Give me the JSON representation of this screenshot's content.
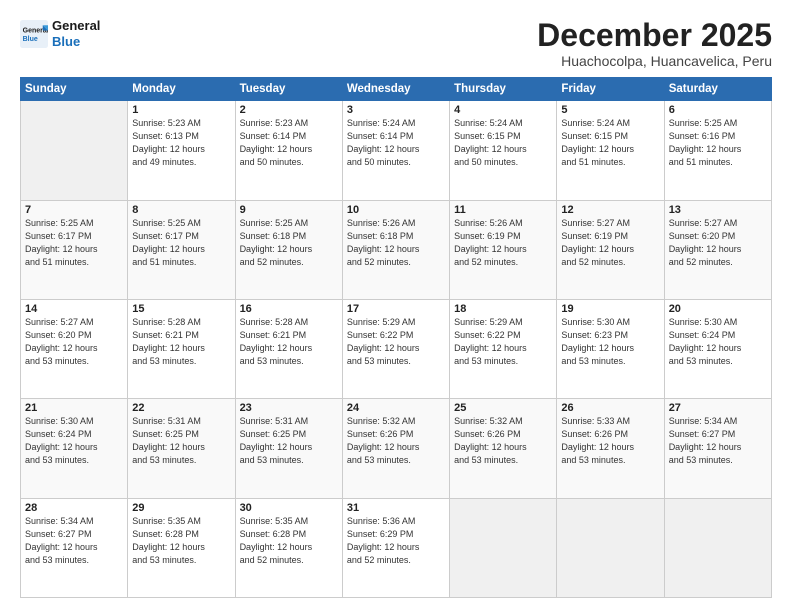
{
  "logo": {
    "line1": "General",
    "line2": "Blue"
  },
  "title": "December 2025",
  "subtitle": "Huachocolpa, Huancavelica, Peru",
  "weekdays": [
    "Sunday",
    "Monday",
    "Tuesday",
    "Wednesday",
    "Thursday",
    "Friday",
    "Saturday"
  ],
  "weeks": [
    [
      {
        "day": null,
        "info": null
      },
      {
        "day": "1",
        "info": "Sunrise: 5:23 AM\nSunset: 6:13 PM\nDaylight: 12 hours\nand 49 minutes."
      },
      {
        "day": "2",
        "info": "Sunrise: 5:23 AM\nSunset: 6:14 PM\nDaylight: 12 hours\nand 50 minutes."
      },
      {
        "day": "3",
        "info": "Sunrise: 5:24 AM\nSunset: 6:14 PM\nDaylight: 12 hours\nand 50 minutes."
      },
      {
        "day": "4",
        "info": "Sunrise: 5:24 AM\nSunset: 6:15 PM\nDaylight: 12 hours\nand 50 minutes."
      },
      {
        "day": "5",
        "info": "Sunrise: 5:24 AM\nSunset: 6:15 PM\nDaylight: 12 hours\nand 51 minutes."
      },
      {
        "day": "6",
        "info": "Sunrise: 5:25 AM\nSunset: 6:16 PM\nDaylight: 12 hours\nand 51 minutes."
      }
    ],
    [
      {
        "day": "7",
        "info": "Sunrise: 5:25 AM\nSunset: 6:17 PM\nDaylight: 12 hours\nand 51 minutes."
      },
      {
        "day": "8",
        "info": "Sunrise: 5:25 AM\nSunset: 6:17 PM\nDaylight: 12 hours\nand 51 minutes."
      },
      {
        "day": "9",
        "info": "Sunrise: 5:25 AM\nSunset: 6:18 PM\nDaylight: 12 hours\nand 52 minutes."
      },
      {
        "day": "10",
        "info": "Sunrise: 5:26 AM\nSunset: 6:18 PM\nDaylight: 12 hours\nand 52 minutes."
      },
      {
        "day": "11",
        "info": "Sunrise: 5:26 AM\nSunset: 6:19 PM\nDaylight: 12 hours\nand 52 minutes."
      },
      {
        "day": "12",
        "info": "Sunrise: 5:27 AM\nSunset: 6:19 PM\nDaylight: 12 hours\nand 52 minutes."
      },
      {
        "day": "13",
        "info": "Sunrise: 5:27 AM\nSunset: 6:20 PM\nDaylight: 12 hours\nand 52 minutes."
      }
    ],
    [
      {
        "day": "14",
        "info": "Sunrise: 5:27 AM\nSunset: 6:20 PM\nDaylight: 12 hours\nand 53 minutes."
      },
      {
        "day": "15",
        "info": "Sunrise: 5:28 AM\nSunset: 6:21 PM\nDaylight: 12 hours\nand 53 minutes."
      },
      {
        "day": "16",
        "info": "Sunrise: 5:28 AM\nSunset: 6:21 PM\nDaylight: 12 hours\nand 53 minutes."
      },
      {
        "day": "17",
        "info": "Sunrise: 5:29 AM\nSunset: 6:22 PM\nDaylight: 12 hours\nand 53 minutes."
      },
      {
        "day": "18",
        "info": "Sunrise: 5:29 AM\nSunset: 6:22 PM\nDaylight: 12 hours\nand 53 minutes."
      },
      {
        "day": "19",
        "info": "Sunrise: 5:30 AM\nSunset: 6:23 PM\nDaylight: 12 hours\nand 53 minutes."
      },
      {
        "day": "20",
        "info": "Sunrise: 5:30 AM\nSunset: 6:24 PM\nDaylight: 12 hours\nand 53 minutes."
      }
    ],
    [
      {
        "day": "21",
        "info": "Sunrise: 5:30 AM\nSunset: 6:24 PM\nDaylight: 12 hours\nand 53 minutes."
      },
      {
        "day": "22",
        "info": "Sunrise: 5:31 AM\nSunset: 6:25 PM\nDaylight: 12 hours\nand 53 minutes."
      },
      {
        "day": "23",
        "info": "Sunrise: 5:31 AM\nSunset: 6:25 PM\nDaylight: 12 hours\nand 53 minutes."
      },
      {
        "day": "24",
        "info": "Sunrise: 5:32 AM\nSunset: 6:26 PM\nDaylight: 12 hours\nand 53 minutes."
      },
      {
        "day": "25",
        "info": "Sunrise: 5:32 AM\nSunset: 6:26 PM\nDaylight: 12 hours\nand 53 minutes."
      },
      {
        "day": "26",
        "info": "Sunrise: 5:33 AM\nSunset: 6:26 PM\nDaylight: 12 hours\nand 53 minutes."
      },
      {
        "day": "27",
        "info": "Sunrise: 5:34 AM\nSunset: 6:27 PM\nDaylight: 12 hours\nand 53 minutes."
      }
    ],
    [
      {
        "day": "28",
        "info": "Sunrise: 5:34 AM\nSunset: 6:27 PM\nDaylight: 12 hours\nand 53 minutes."
      },
      {
        "day": "29",
        "info": "Sunrise: 5:35 AM\nSunset: 6:28 PM\nDaylight: 12 hours\nand 53 minutes."
      },
      {
        "day": "30",
        "info": "Sunrise: 5:35 AM\nSunset: 6:28 PM\nDaylight: 12 hours\nand 52 minutes."
      },
      {
        "day": "31",
        "info": "Sunrise: 5:36 AM\nSunset: 6:29 PM\nDaylight: 12 hours\nand 52 minutes."
      },
      {
        "day": null,
        "info": null
      },
      {
        "day": null,
        "info": null
      },
      {
        "day": null,
        "info": null
      }
    ]
  ]
}
